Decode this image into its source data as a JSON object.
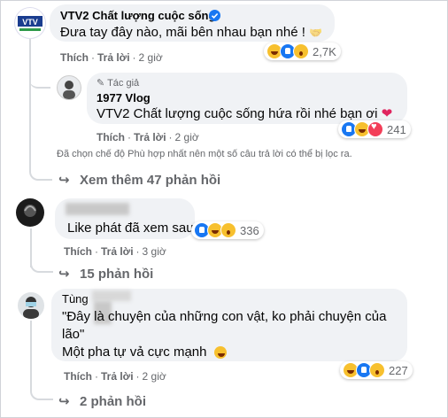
{
  "comment1": {
    "author": "VTV2 Chất lượng cuộc sống",
    "verified": true,
    "text": "Đưa tay đây nào, mãi bên nhau bạn nhé !",
    "emoji": "🤝",
    "like_label": "Thích",
    "reply_label": "Trả lời",
    "time": "2 giờ",
    "reaction_count": "2,7K",
    "reactions": [
      "haha-icon",
      "like-icon",
      "wow-icon"
    ]
  },
  "reply1": {
    "author_badge": "Tác giả",
    "author": "1977 Vlog",
    "mention": "VTV2 Chất lượng cuộc sống",
    "text": " hứa rồi nhé bạn ơi",
    "like_label": "Thích",
    "reply_label": "Trả lời",
    "time": "2 giờ",
    "reaction_count": "241",
    "reactions": [
      "like-icon",
      "haha-icon",
      "love-icon"
    ]
  },
  "filter_notice": "Đã chọn chế độ Phù hợp nhất nên một số câu trả lời có thể bị lọc ra.",
  "see_more_1": "Xem thêm 47 phản hồi",
  "comment2": {
    "text": "Like phát đã xem sau.",
    "like_label": "Thích",
    "reply_label": "Trả lời",
    "time": "3 giờ",
    "reaction_count": "336",
    "reactions": [
      "like-icon",
      "haha-icon",
      "wow-icon"
    ]
  },
  "replies_2": "15 phản hồi",
  "comment3": {
    "author": "Tùng",
    "text_line1": "\"Đây là chuyện của những con vật, ko phải chuyện của",
    "text_line2": "lão\"",
    "text_line3": "Một pha tự vả cực mạnh",
    "like_label": "Thích",
    "reply_label": "Trả lời",
    "time": "2 giờ",
    "reaction_count": "227",
    "reactions": [
      "haha-icon",
      "like-icon",
      "wow-icon"
    ]
  },
  "replies_3": "2 phản hồi"
}
